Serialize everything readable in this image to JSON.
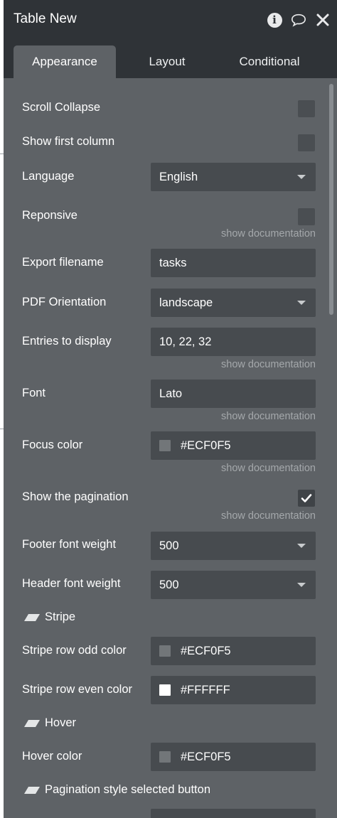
{
  "window": {
    "title": "Table New"
  },
  "tabs": [
    "Appearance",
    "Layout",
    "Conditional"
  ],
  "rows": {
    "scroll_collapse": {
      "label": "Scroll Collapse",
      "checked": false
    },
    "show_first_column": {
      "label": "Show first column",
      "checked": false
    },
    "language": {
      "label": "Language",
      "value": "English"
    },
    "responsive": {
      "label": "Reponsive",
      "checked": false,
      "doc": "show documentation"
    },
    "export_filename": {
      "label": "Export filename",
      "value": "tasks"
    },
    "pdf_orientation": {
      "label": "PDF Orientation",
      "value": "landscape"
    },
    "entries_to_display": {
      "label": "Entries to display",
      "value": "10, 22, 32",
      "doc": "show documentation"
    },
    "font": {
      "label": "Font",
      "value": "Lato",
      "doc": "show documentation"
    },
    "focus_color": {
      "label": "Focus color",
      "value": "#ECF0F5",
      "swatch": "#727679",
      "doc": "show documentation"
    },
    "show_pagination": {
      "label": "Show the pagination",
      "checked": true,
      "doc": "show documentation"
    },
    "footer_font_weight": {
      "label": "Footer font weight",
      "value": "500"
    },
    "header_font_weight": {
      "label": "Header font weight",
      "value": "500"
    },
    "stripe_odd": {
      "label": "Stripe row odd color",
      "value": "#ECF0F5",
      "swatch": "#727679"
    },
    "stripe_even": {
      "label": "Stripe row even color",
      "value": "#FFFFFF",
      "swatch": "#FFFFFF"
    },
    "hover_color": {
      "label": "Hover color",
      "value": "#ECF0F5",
      "swatch": "#727679"
    }
  },
  "sections": {
    "stripe": "Stripe",
    "hover": "Hover",
    "pagination_selected": "Pagination style selected button"
  },
  "colors": {
    "panel_bg": "#5E6266",
    "titlebar_bg": "#2F3337",
    "field_bg": "#474B4F",
    "doc_link": "#A4A8AB"
  },
  "icons": [
    "info-icon",
    "comment-icon",
    "close-icon",
    "chevron-down-icon",
    "checkmark-icon",
    "pencil-icon"
  ]
}
